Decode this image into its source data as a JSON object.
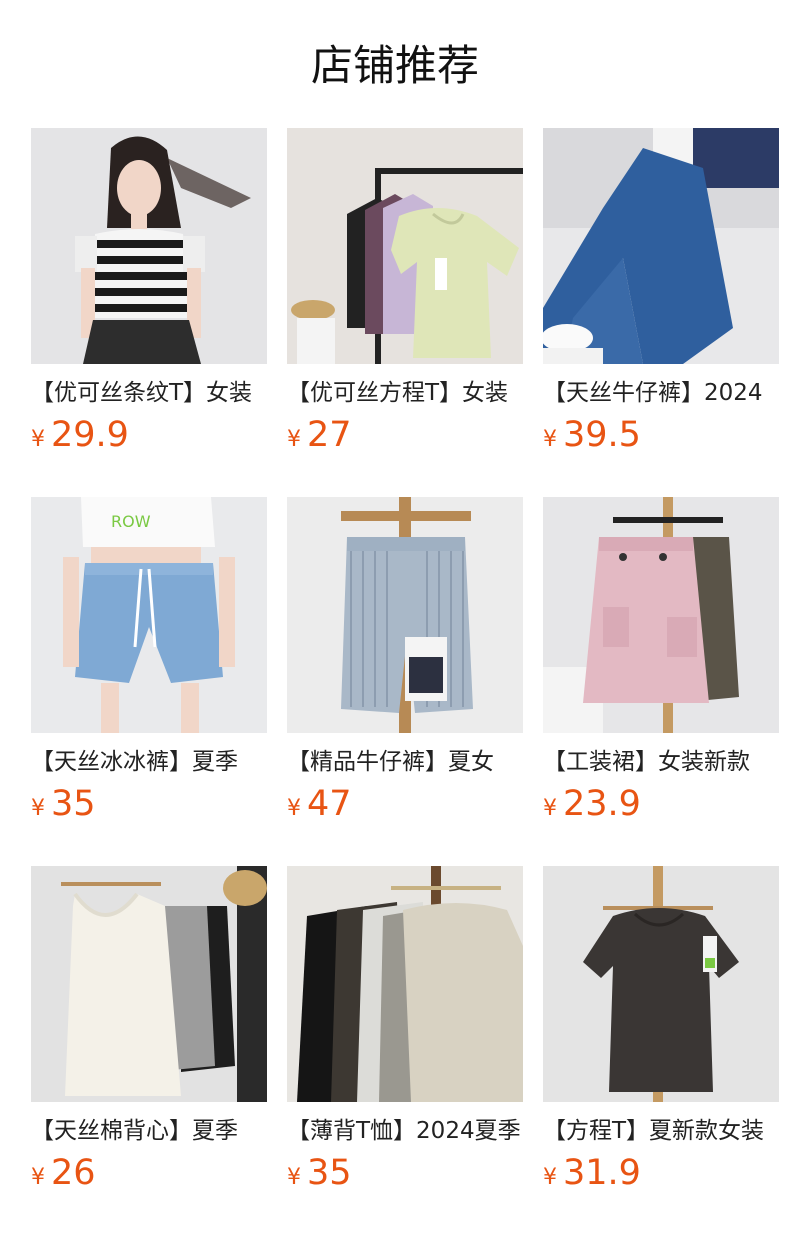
{
  "title": "店铺推荐",
  "products": [
    {
      "name": "【优可丝条纹T】女装",
      "currency": "¥",
      "price": "29.9",
      "image": "striped-top-photo"
    },
    {
      "name": "【优可丝方程T】女装",
      "currency": "¥",
      "price": "27",
      "image": "tee-rack-photo"
    },
    {
      "name": "【天丝牛仔裤】2024",
      "currency": "¥",
      "price": "39.5",
      "image": "denim-jeans-photo"
    },
    {
      "name": "【天丝冰冰裤】夏季",
      "currency": "¥",
      "price": "35",
      "image": "denim-shorts-photo"
    },
    {
      "name": "【精品牛仔裤】夏女",
      "currency": "¥",
      "price": "47",
      "image": "striped-denim-shorts-photo"
    },
    {
      "name": "【工装裙】女装新款",
      "currency": "¥",
      "price": "23.9",
      "image": "cargo-skirt-photo"
    },
    {
      "name": "【天丝棉背心】夏季",
      "currency": "¥",
      "price": "26",
      "image": "tank-top-photo"
    },
    {
      "name": "【薄背T恤】2024夏季",
      "currency": "¥",
      "price": "35",
      "image": "tee-stack-photo"
    },
    {
      "name": "【方程T】夏新款女装",
      "currency": "¥",
      "price": "31.9",
      "image": "dark-tee-photo"
    }
  ]
}
